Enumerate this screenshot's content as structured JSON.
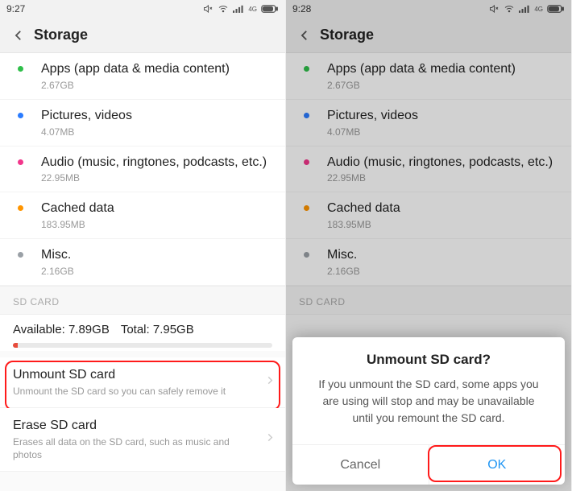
{
  "left": {
    "time": "9:27",
    "title": "Storage",
    "items": [
      {
        "dot": "#2fbf4a",
        "title": "Apps (app data & media content)",
        "sub": "2.67GB"
      },
      {
        "dot": "#2b7cff",
        "title": "Pictures, videos",
        "sub": "4.07MB"
      },
      {
        "dot": "#f2368b",
        "title": "Audio (music, ringtones, podcasts, etc.)",
        "sub": "22.95MB"
      },
      {
        "dot": "#ff9500",
        "title": "Cached data",
        "sub": "183.95MB"
      },
      {
        "dot": "#9aa0a6",
        "title": "Misc.",
        "sub": "2.16GB"
      }
    ],
    "sd": {
      "header": "SD CARD",
      "available_label": "Available:",
      "available": "7.89GB",
      "total_label": "Total:",
      "total": "7.95GB"
    },
    "actions": {
      "unmount_title": "Unmount SD card",
      "unmount_desc": "Unmount the SD card so you can safely remove it",
      "erase_title": "Erase SD card",
      "erase_desc": "Erases all data on the SD card, such as music and photos"
    }
  },
  "right": {
    "time": "9:28",
    "title": "Storage",
    "dialog": {
      "title": "Unmount SD card?",
      "message": "If you unmount the SD card, some apps you are using will stop and may be unavailable until you remount the SD card.",
      "cancel": "Cancel",
      "ok": "OK"
    }
  }
}
